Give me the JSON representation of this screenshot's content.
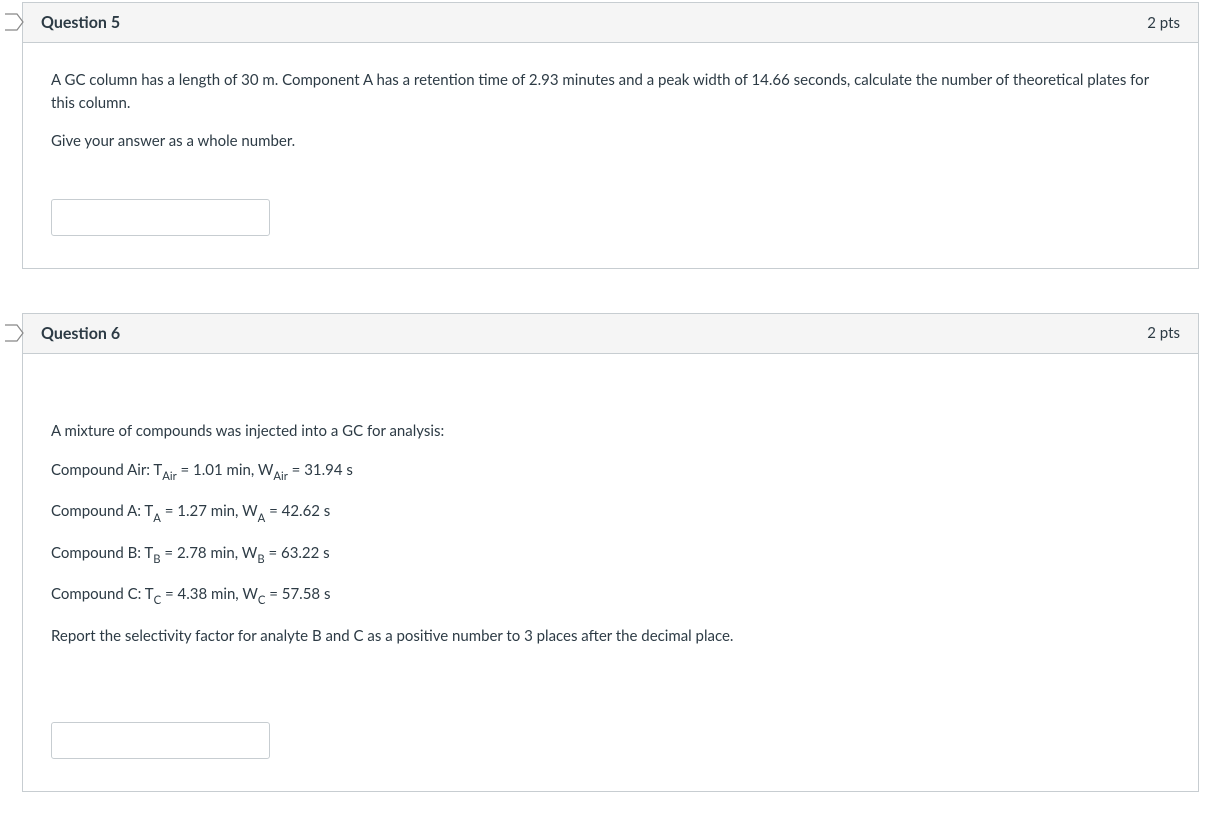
{
  "questions": [
    {
      "title": "Question 5",
      "points": "2 pts",
      "paragraphs": [
        "A GC column has a length of 30 m.  Component A has a retention time of 2.93 minutes and a peak width of 14.66 seconds, calculate the number of theoretical plates for this column.",
        "Give your answer as a whole number."
      ],
      "answer_value": ""
    },
    {
      "title": "Question 6",
      "points": "2 pts",
      "intro": "A mixture of compounds was injected into a GC for analysis:",
      "lines": {
        "air_prefix": "Compound Air: T",
        "air_sub1": "Air",
        "air_mid": " = 1.01 min, W",
        "air_sub2": "Air",
        "air_end": " = 31.94 s",
        "a_prefix": "Compound A:  T",
        "a_sub1": "A",
        "a_mid": " = 1.27 min, W",
        "a_sub2": "A",
        "a_end": " = 42.62 s",
        "b_prefix": "Compound B:  T",
        "b_sub1": "B",
        "b_mid": " = 2.78 min, W",
        "b_sub2": "B",
        "b_end": " = 63.22 s",
        "c_prefix": "Compound C:  T",
        "c_sub1": "C",
        "c_mid": " = 4.38 min, W",
        "c_sub2": "C",
        "c_end": " = 57.58 s"
      },
      "closing": "Report the selectivity factor for analyte B and C as a positive number to 3 places after the decimal place.",
      "answer_value": ""
    }
  ]
}
